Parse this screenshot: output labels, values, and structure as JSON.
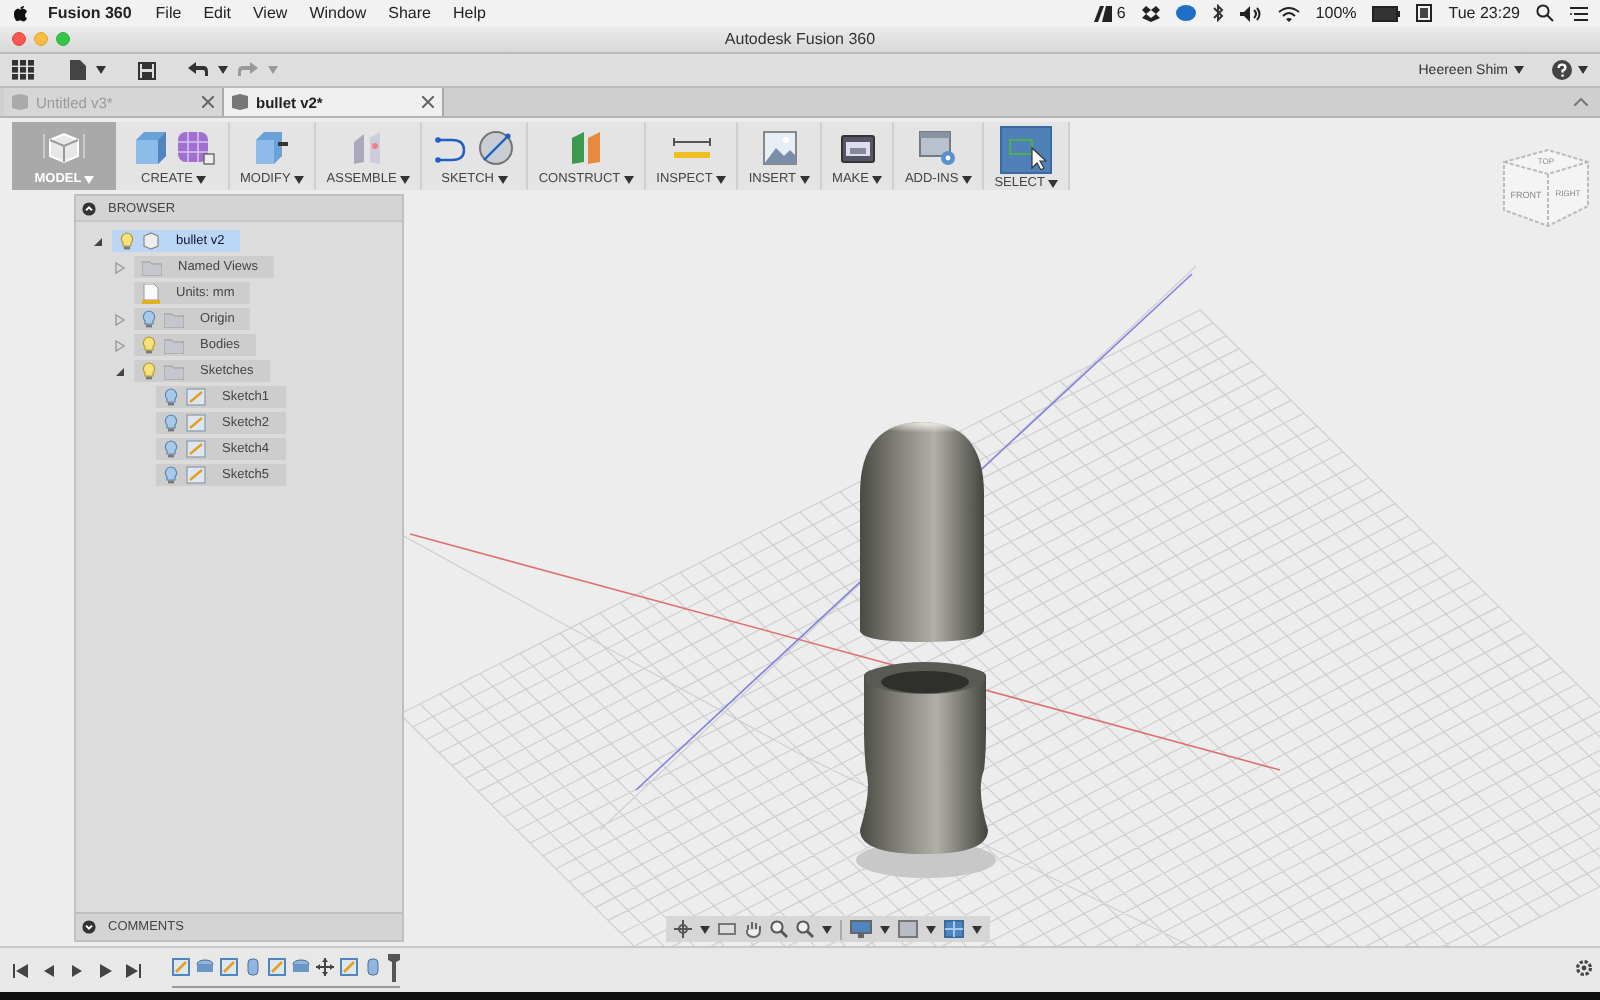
{
  "menubar": {
    "app_name": "Fusion 360",
    "menus": [
      "File",
      "Edit",
      "View",
      "Window",
      "Share",
      "Help"
    ],
    "badge_count": "6",
    "battery": "100%",
    "clock": "Tue 23:29"
  },
  "window": {
    "title": "Autodesk Fusion 360"
  },
  "quick_access": {
    "user": "Heereen Shim"
  },
  "tabs": [
    {
      "label": "Untitled v3*",
      "selected": false
    },
    {
      "label": "bullet v2*",
      "selected": true
    }
  ],
  "ribbon": {
    "workspace": "MODEL",
    "groups": [
      {
        "label": "CREATE",
        "kind": "create",
        "selected": false
      },
      {
        "label": "MODIFY",
        "kind": "modify",
        "selected": false
      },
      {
        "label": "ASSEMBLE",
        "kind": "assemble",
        "selected": false
      },
      {
        "label": "SKETCH",
        "kind": "sketch",
        "selected": false
      },
      {
        "label": "CONSTRUCT",
        "kind": "construct",
        "selected": false
      },
      {
        "label": "INSPECT",
        "kind": "inspect",
        "selected": false
      },
      {
        "label": "INSERT",
        "kind": "insert",
        "selected": false
      },
      {
        "label": "MAKE",
        "kind": "make",
        "selected": false
      },
      {
        "label": "ADD-INS",
        "kind": "addins",
        "selected": false
      },
      {
        "label": "SELECT",
        "kind": "select",
        "selected": true
      }
    ]
  },
  "browser": {
    "title": "BROWSER",
    "tree": [
      {
        "label": "bullet v2",
        "kind": "component",
        "selected": true,
        "visible": true,
        "expanded": true,
        "children": [
          {
            "label": "Named Views",
            "kind": "views",
            "selected": false,
            "expanded": false
          },
          {
            "label": "Units: mm",
            "kind": "units",
            "selected": false
          },
          {
            "label": "Origin",
            "kind": "folder",
            "selected": false,
            "visible": false,
            "expanded": false
          },
          {
            "label": "Bodies",
            "kind": "folder",
            "selected": false,
            "visible": true,
            "expanded": false
          },
          {
            "label": "Sketches",
            "kind": "folder",
            "selected": false,
            "visible": true,
            "expanded": true,
            "children": [
              {
                "label": "Sketch1",
                "kind": "sketch",
                "selected": false,
                "visible": false
              },
              {
                "label": "Sketch2",
                "kind": "sketch",
                "selected": false,
                "visible": false
              },
              {
                "label": "Sketch4",
                "kind": "sketch",
                "selected": false,
                "visible": false
              },
              {
                "label": "Sketch5",
                "kind": "sketch",
                "selected": false,
                "visible": false
              }
            ]
          }
        ]
      }
    ],
    "comments": "COMMENTS"
  },
  "viewcube": {
    "faces": [
      "TOP",
      "FRONT",
      "RIGHT"
    ]
  }
}
